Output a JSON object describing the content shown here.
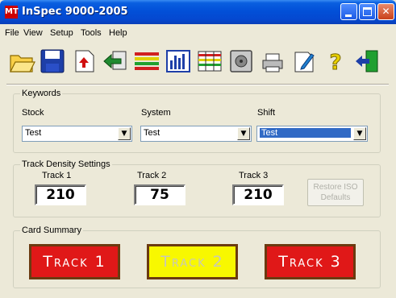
{
  "window": {
    "title": "InSpec 9000-2005",
    "app_icon_text": "MT"
  },
  "menu": [
    "File",
    "View",
    "Setup",
    "Tools",
    "Help"
  ],
  "toolbar": {
    "icons": [
      "open-folder-icon",
      "save-disk-icon",
      "upload-document-icon",
      "return-arrow-icon",
      "ruler-stripes-icon",
      "bar-chart-icon",
      "grid-stripes-icon",
      "safe-icon",
      "printer-icon",
      "edit-document-icon",
      "help-question-icon",
      "exit-door-icon"
    ]
  },
  "keywords": {
    "group_label": "Keywords",
    "stock_label": "Stock",
    "stock_value": "Test",
    "system_label": "System",
    "system_value": "Test",
    "shift_label": "Shift",
    "shift_value": "Test"
  },
  "track_density": {
    "group_label": "Track Density Settings",
    "track1_label": "Track 1",
    "track1_value": "210",
    "track2_label": "Track 2",
    "track2_value": "75",
    "track3_label": "Track 3",
    "track3_value": "210",
    "restore_label": "Restore ISO Defaults"
  },
  "card_summary": {
    "group_label": "Card Summary",
    "track1": "Track 1",
    "track2": "Track 2",
    "track3": "Track 3"
  },
  "colors": {
    "title_bar": "#0250d8",
    "card_red": "#e01818",
    "card_yellow": "#f8f800"
  }
}
